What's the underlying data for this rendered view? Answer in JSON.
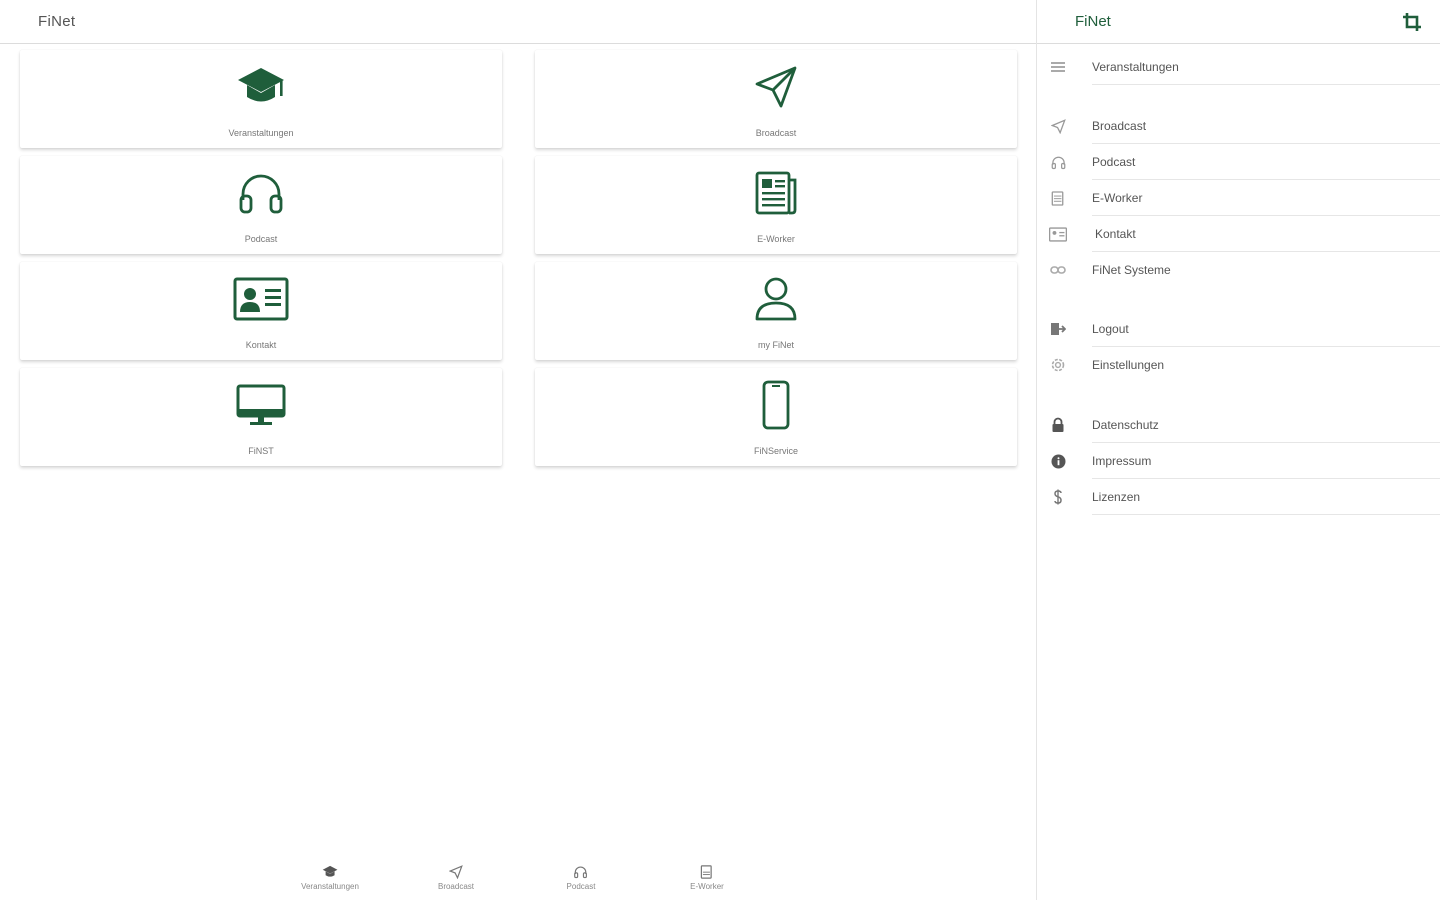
{
  "app": {
    "title": "FiNet"
  },
  "tiles": [
    {
      "label": "Veranstaltungen",
      "icon": "graduation-cap-icon"
    },
    {
      "label": "Broadcast",
      "icon": "paper-plane-icon"
    },
    {
      "label": "Podcast",
      "icon": "headphones-icon"
    },
    {
      "label": "E-Worker",
      "icon": "newspaper-icon"
    },
    {
      "label": "Kontakt",
      "icon": "contact-card-icon"
    },
    {
      "label": "my FiNet",
      "icon": "user-icon"
    },
    {
      "label": "FiNST",
      "icon": "monitor-icon"
    },
    {
      "label": "FiNService",
      "icon": "smartphone-icon"
    }
  ],
  "bottom_nav": [
    {
      "label": "Veranstaltungen",
      "icon": "graduation-cap-icon"
    },
    {
      "label": "Broadcast",
      "icon": "paper-plane-icon"
    },
    {
      "label": "Podcast",
      "icon": "headphones-icon"
    },
    {
      "label": "E-Worker",
      "icon": "newspaper-icon"
    }
  ],
  "drawer": {
    "title": "FiNet",
    "collapse_icon": "crop-icon",
    "items": [
      {
        "label": "Veranstaltungen",
        "icon": "menu-lines-icon"
      },
      {
        "label": "Broadcast",
        "icon": "paper-plane-icon"
      },
      {
        "label": "Podcast",
        "icon": "headphones-icon"
      },
      {
        "label": "E-Worker",
        "icon": "newspaper-icon"
      },
      {
        "label": "Kontakt",
        "icon": "contact-card-icon"
      },
      {
        "label": "FiNet Systeme",
        "icon": "link-icon"
      },
      {
        "label": "Logout",
        "icon": "logout-icon"
      },
      {
        "label": "Einstellungen",
        "icon": "gear-icon"
      },
      {
        "label": "Datenschutz",
        "icon": "lock-icon"
      },
      {
        "label": "Impressum",
        "icon": "info-icon"
      },
      {
        "label": "Lizenzen",
        "icon": "dollar-icon"
      }
    ]
  },
  "colors": {
    "accent": "#1f5e3b",
    "muted_icon": "#9a9a9a"
  }
}
